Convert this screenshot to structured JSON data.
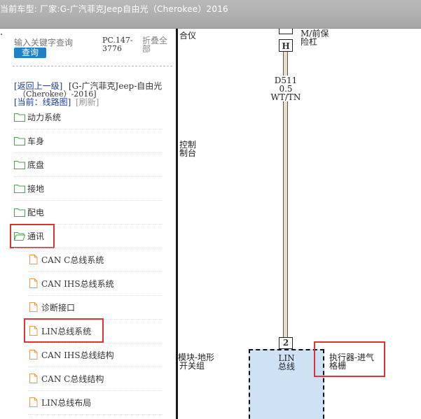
{
  "window": {
    "title": "当前车型:  厂家:G-广汽菲克Jeep自由光（Cherokee）2016"
  },
  "search": {
    "placeholder": "输入关键字查询",
    "button_label": "查询"
  },
  "toolbar": {
    "pc_code": "PC.147-3776",
    "collapse_all_label": "折叠全部"
  },
  "nav": {
    "back_label": "[返回上一级]",
    "breadcrumb_line1": "[G-广汽菲克Jeep-自由光",
    "breadcrumb_line2": "（Cherokee）-2016]",
    "current_label": "[当前：线路图]",
    "refresh_label": "[刷新]"
  },
  "tree": {
    "folders": [
      {
        "label": "动力系统",
        "open": false
      },
      {
        "label": "车身",
        "open": false
      },
      {
        "label": "底盘",
        "open": false
      },
      {
        "label": "接地",
        "open": false
      },
      {
        "label": "配电",
        "open": false
      },
      {
        "label": "通讯",
        "open": true
      }
    ],
    "documents": [
      {
        "label": "CAN C总线系统"
      },
      {
        "label": "CAN IHS总线系统"
      },
      {
        "label": "诊断接口"
      },
      {
        "label": "LIN总线系统"
      },
      {
        "label": "CAN IHS总线结构"
      },
      {
        "label": "CAN C总线结构"
      },
      {
        "label": "LIN总线布局"
      }
    ]
  },
  "diagram": {
    "top_left_text": "合仪",
    "top_right_line1": "M/前保",
    "top_right_line2": "险杠",
    "connector_h": "H",
    "wire_id": "D511",
    "wire_gauge": "0.5",
    "wire_color": "WT/TN",
    "left_mid_line1": "控制",
    "left_mid_line2": "制台",
    "pin_number": "2",
    "module_label_line1": "LIN",
    "module_label_line2": "总线",
    "left_bottom_line1": "模块-地形",
    "left_bottom_line2": "开关组",
    "actuator_line1": "执行器-进气",
    "actuator_line2": "格栅"
  },
  "colors": {
    "titlebar": "#b0b0b0",
    "query_button": "#1f82c6",
    "highlight": "#dd3333",
    "module_fill": "#cfe2f5",
    "folder_icon": "#4aa34a",
    "doc_icon": "#e89a3c"
  }
}
